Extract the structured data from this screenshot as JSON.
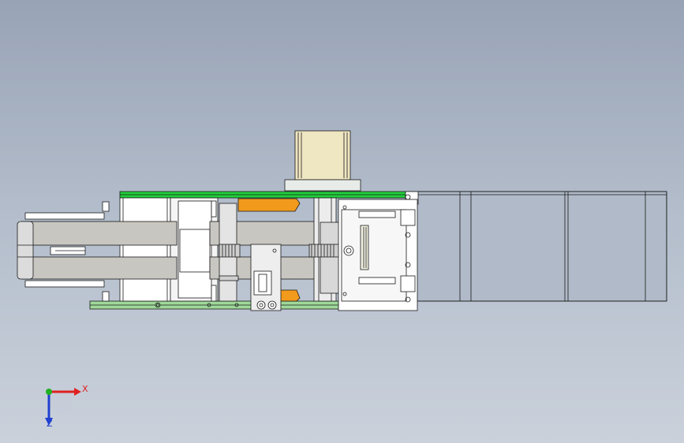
{
  "viewport": {
    "background_top": "#98a3b6",
    "background_bottom": "#cad1db",
    "model": "mechanism-assembly-top-view"
  },
  "triad": {
    "x_label": "X",
    "z_label": "Z",
    "x_color": "#e02020",
    "y_color": "#20b020",
    "z_color": "#2040d0"
  },
  "colors": {
    "green_plate": "#22d03c",
    "light_green_plate": "#9fd99a",
    "orange_bracket": "#f29a1c",
    "motor_body": "#efe6c2",
    "frame": "#ffffff",
    "belt": "#c8c6c0",
    "outline": "#1a1a1a"
  }
}
